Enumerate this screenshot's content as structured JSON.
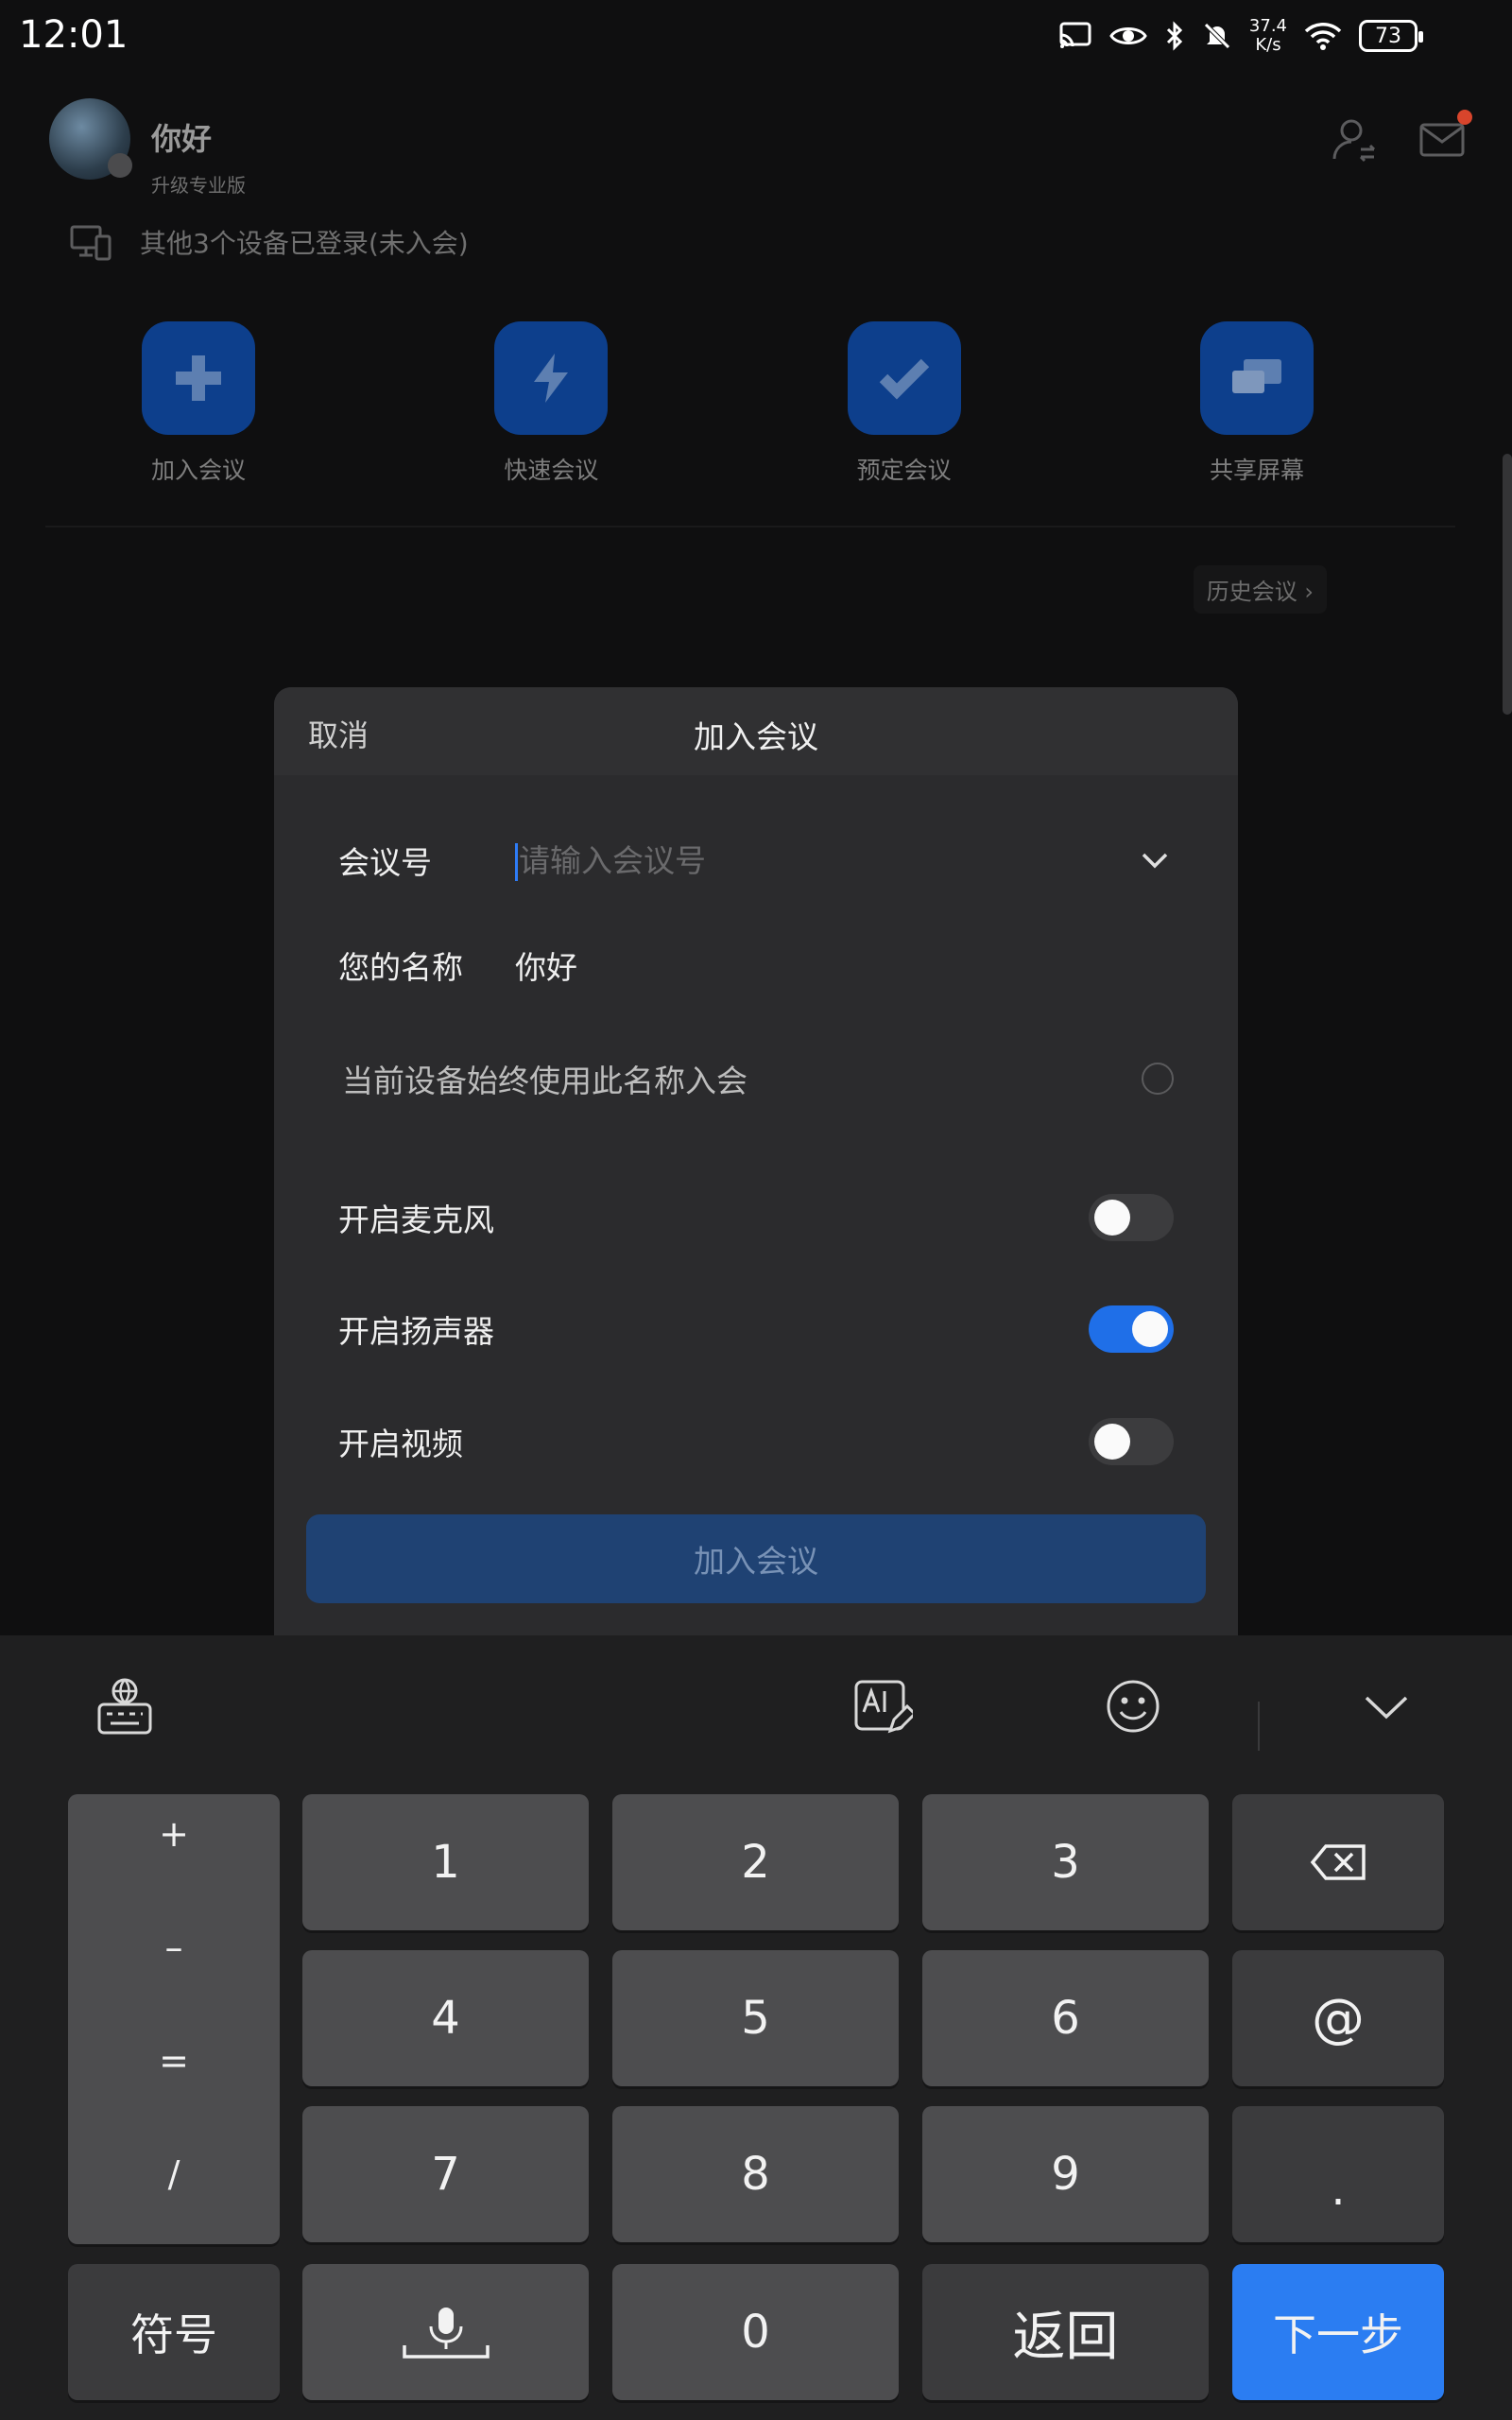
{
  "status_bar": {
    "time": "12:01",
    "net_speed_value": "37.4",
    "net_speed_unit": "K/s",
    "battery": "73"
  },
  "profile": {
    "name": "你好",
    "upgrade_label": "升级专业版"
  },
  "devices_notice": "其他3个设备已登录(未入会)",
  "quick_actions": [
    {
      "label": "加入会议",
      "icon": "plus-icon"
    },
    {
      "label": "快速会议",
      "icon": "lightning-icon"
    },
    {
      "label": "预定会议",
      "icon": "check-icon"
    },
    {
      "label": "共享屏幕",
      "icon": "screen-share-icon"
    }
  ],
  "history_link": "历史会议 ›",
  "dialog": {
    "cancel": "取消",
    "title": "加入会议",
    "meeting_id_label": "会议号",
    "meeting_id_value": "",
    "meeting_id_placeholder": "请输入会议号",
    "name_label": "您的名称",
    "name_value": "你好",
    "remember_label": "当前设备始终使用此名称入会",
    "toggles": [
      {
        "label": "开启麦克风",
        "on": false
      },
      {
        "label": "开启扬声器",
        "on": true
      },
      {
        "label": "开启视频",
        "on": false
      }
    ],
    "join_button": "加入会议"
  },
  "keyboard": {
    "symbols": [
      "+",
      "–",
      "=",
      "/"
    ],
    "keys": {
      "k1": "1",
      "k2": "2",
      "k3": "3",
      "k4": "4",
      "k5": "5",
      "k6": "6",
      "k7": "7",
      "k8": "8",
      "k9": "9",
      "k0": "0",
      "at": "@",
      "dot": ".",
      "symbol_mode": "符号",
      "back": "返回",
      "next": "下一步"
    }
  },
  "colors": {
    "accent": "#2b7df2",
    "toggle_on": "#1f6fe8",
    "join_disabled": "#1f4273",
    "quick_action_bg": "#0d3f8c"
  }
}
